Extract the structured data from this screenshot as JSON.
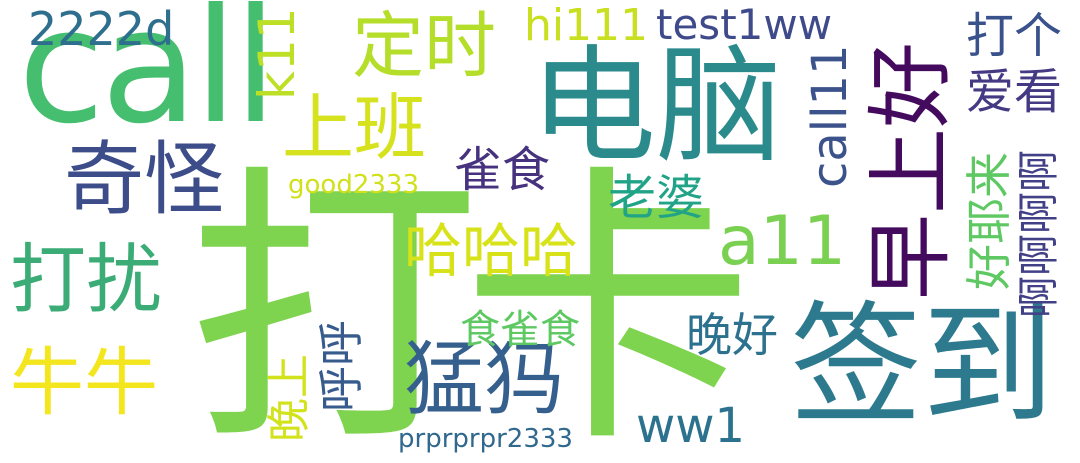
{
  "words": [
    {
      "id": "daka",
      "text": "打卡",
      "color": "#7ed34f"
    },
    {
      "id": "call",
      "text": "call",
      "color": "#45bf6f"
    },
    {
      "id": "diannao",
      "text": "电脑",
      "color": "#2a8a8c"
    },
    {
      "id": "qiandao",
      "text": "签到",
      "color": "#2d7a8e"
    },
    {
      "id": "zaoshanghao",
      "text": "早上好",
      "color": "#440a5e"
    },
    {
      "id": "dingshi",
      "text": "定时",
      "color": "#b5de2b"
    },
    {
      "id": "shangban",
      "text": "上班",
      "color": "#d6e21d"
    },
    {
      "id": "qiguai",
      "text": "奇怪",
      "color": "#3d4d8a"
    },
    {
      "id": "darao",
      "text": "打扰",
      "color": "#3bac76"
    },
    {
      "id": "niuniu",
      "text": "牛牛",
      "color": "#f4e61e"
    },
    {
      "id": "menggou",
      "text": "猛犸",
      "color": "#355f8d"
    },
    {
      "id": "hahaha",
      "text": "哈哈哈",
      "color": "#d8e219"
    },
    {
      "id": "a11",
      "text": "a11",
      "color": "#7ad151"
    },
    {
      "id": "test1ww",
      "text": "test1ww",
      "color": "#3e4a89"
    },
    {
      "id": "hi111",
      "text": "hi111",
      "color": "#c8e020"
    },
    {
      "id": "k11",
      "text": "k11",
      "color": "#bddf26"
    },
    {
      "id": "2222d",
      "text": "2222d",
      "color": "#2e6f8e"
    },
    {
      "id": "dage",
      "text": "打个",
      "color": "#3a528b"
    },
    {
      "id": "aikan",
      "text": "爱看",
      "color": "#443983"
    },
    {
      "id": "call11",
      "text": "call11",
      "color": "#3b528b"
    },
    {
      "id": "haoyelai",
      "text": "好耶来",
      "color": "#5ec962"
    },
    {
      "id": "aaaaa",
      "text": "啊啊啊啊",
      "color": "#424086"
    },
    {
      "id": "queshi",
      "text": "雀食",
      "color": "#46327e"
    },
    {
      "id": "laopo",
      "text": "老婆",
      "color": "#20a386"
    },
    {
      "id": "good2333",
      "text": "good2333",
      "color": "#d0e11c"
    },
    {
      "id": "shiqueshi",
      "text": "食雀食",
      "color": "#5ec962"
    },
    {
      "id": "wanhao",
      "text": "晚好",
      "color": "#2c728e"
    },
    {
      "id": "wanshang",
      "text": "晚上",
      "color": "#d2e21b"
    },
    {
      "id": "huhu",
      "text": "呼呼",
      "color": "#375b8d"
    },
    {
      "id": "ww1",
      "text": "ww1",
      "color": "#2c728e"
    },
    {
      "id": "prpr",
      "text": "prprprpr2333",
      "color": "#30688e"
    }
  ]
}
